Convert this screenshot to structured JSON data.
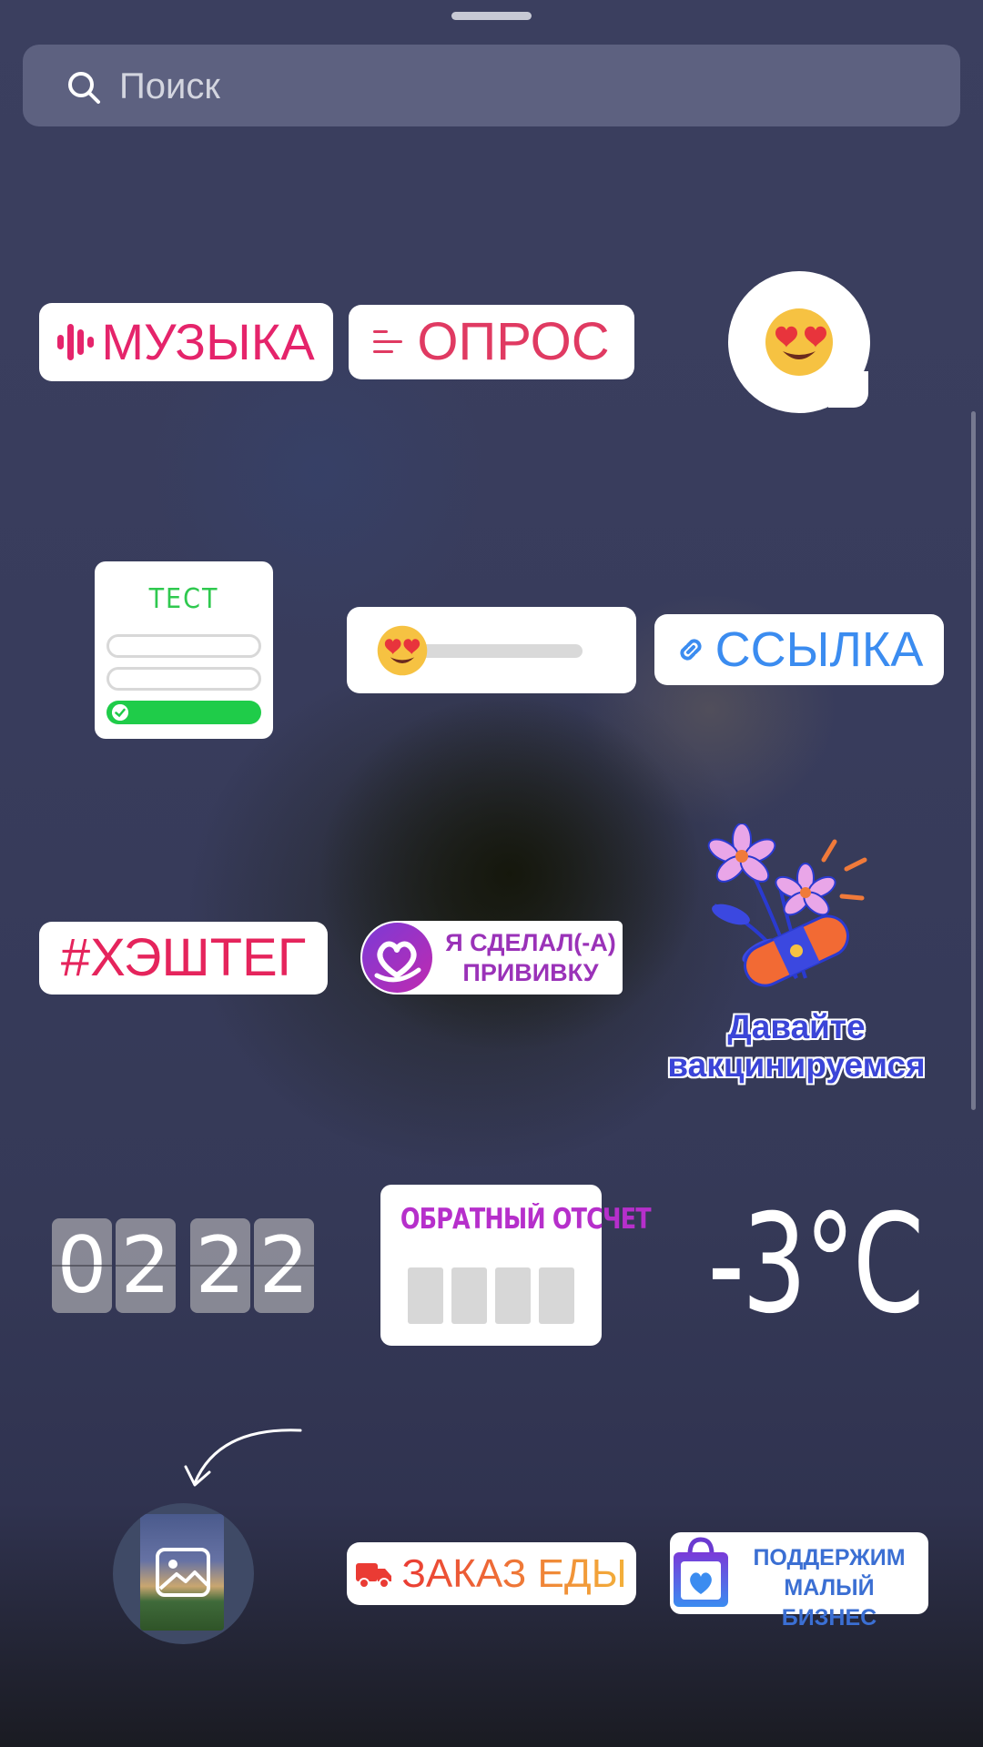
{
  "search": {
    "placeholder": "Поиск"
  },
  "stickers": {
    "music": {
      "label": "МУЗЫКА"
    },
    "poll": {
      "label": "ОПРОС"
    },
    "emoji_reaction": {
      "emoji": "😍"
    },
    "quiz": {
      "title": "ТЕСТ"
    },
    "emoji_slider": {
      "emoji": "😍"
    },
    "link": {
      "label": "ССЫЛКА"
    },
    "hashtag": {
      "label": "#ХЭШТЕГ"
    },
    "vaccinated": {
      "text": "Я СДЕЛАЛ(-А) ПРИВИВКУ"
    },
    "lets_vaccinate": {
      "line1": "Давайте",
      "line2": "вакцинируемся"
    },
    "clock": {
      "digits": [
        "0",
        "2",
        "2",
        "2"
      ]
    },
    "countdown": {
      "title": "ОБРАТНЫЙ ОТСЧЕТ"
    },
    "temperature": {
      "value": "-3°C"
    },
    "food_order": {
      "label": "ЗАКАЗ ЕДЫ"
    },
    "support_business": {
      "line1": "ПОДДЕРЖИМ",
      "line2": "МАЛЫЙ БИЗНЕС"
    }
  },
  "colors": {
    "background": "#3a3e5e",
    "music": "#e5246b",
    "poll": "#e03a62",
    "quiz_green": "#1fcc49",
    "link": "#3b8cf0",
    "hashtag": "#e5245c",
    "vax_purple": "#9a32b8",
    "countdown_purple": "#b62fcb",
    "business_blue": "#3b6fd3"
  }
}
